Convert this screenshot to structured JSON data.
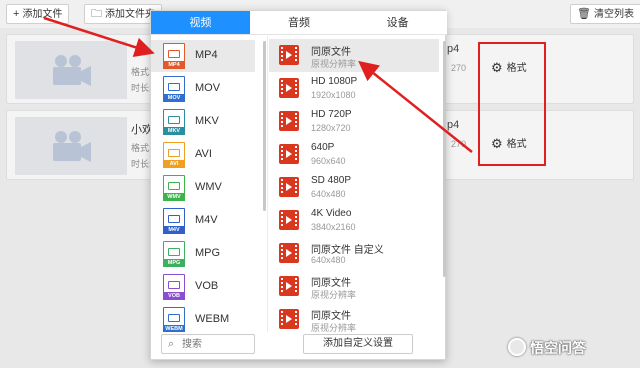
{
  "toolbar": {
    "add_file": "添加文件",
    "add_folder": "添加文件夹",
    "clear_list": "清空列表"
  },
  "rows": [
    {
      "name": "",
      "meta1": "格式:",
      "meta2": "时长:",
      "right_text": "p4",
      "right_sub": "270",
      "format_button": "格式"
    },
    {
      "name": "小欢",
      "meta1": "格式:",
      "meta2": "时长:",
      "right_text": "p4",
      "right_sub": "270",
      "format_button": "格式"
    }
  ],
  "popup": {
    "tabs": [
      {
        "label": "视频",
        "active": true
      },
      {
        "label": "音频",
        "active": false
      },
      {
        "label": "设备",
        "active": false
      }
    ],
    "formats": [
      {
        "label": "MP4",
        "tag": "MP4",
        "color": "#e05a2b",
        "selected": true
      },
      {
        "label": "MOV",
        "tag": "MOV",
        "color": "#2f6fd0",
        "selected": false
      },
      {
        "label": "MKV",
        "tag": "MKV",
        "color": "#2a8fa0",
        "selected": false
      },
      {
        "label": "AVI",
        "tag": "AVI",
        "color": "#f0a020",
        "selected": false
      },
      {
        "label": "WMV",
        "tag": "WMV",
        "color": "#3cb44a",
        "selected": false
      },
      {
        "label": "M4V",
        "tag": "M4V",
        "color": "#3060c8",
        "selected": false
      },
      {
        "label": "MPG",
        "tag": "MPG",
        "color": "#3cb060",
        "selected": false
      },
      {
        "label": "VOB",
        "tag": "VOB",
        "color": "#8a4fd0",
        "selected": false
      },
      {
        "label": "WEBM",
        "tag": "WEBM",
        "color": "#2f6fd0",
        "selected": false
      }
    ],
    "resolutions": [
      {
        "title": "同原文件",
        "sub": "原视分辨率",
        "selected": true
      },
      {
        "title": "HD 1080P",
        "sub": "1920x1080",
        "selected": false
      },
      {
        "title": "HD 720P",
        "sub": "1280x720",
        "selected": false
      },
      {
        "title": "640P",
        "sub": "960x640",
        "selected": false
      },
      {
        "title": "SD 480P",
        "sub": "640x480",
        "selected": false
      },
      {
        "title": "4K Video",
        "sub": "3840x2160",
        "selected": false
      },
      {
        "title": "同原文件 自定义",
        "sub": "640x480",
        "selected": false
      },
      {
        "title": "同原文件",
        "sub": "原视分辨率",
        "selected": false
      },
      {
        "title": "同原文件",
        "sub": "原视分辨率",
        "selected": false
      }
    ],
    "search_placeholder": "搜索",
    "custom_button": "添加自定义设置"
  },
  "watermark": "悟空问答",
  "colors": {
    "accent": "#1e90ff",
    "annotation_red": "#e02020",
    "film_icon": "#d9381e"
  }
}
